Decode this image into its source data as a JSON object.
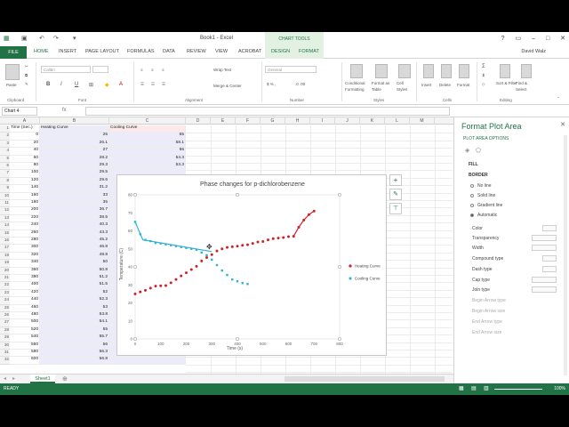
{
  "window": {
    "title": "Book1 - Excel",
    "chart_tools": "CHART TOOLS",
    "user": "David Walz"
  },
  "tabs": [
    "HOME",
    "INSERT",
    "PAGE LAYOUT",
    "FORMULAS",
    "DATA",
    "REVIEW",
    "VIEW",
    "ACROBAT",
    "DESIGN",
    "FORMAT"
  ],
  "file_tab": "FILE",
  "ribbon": {
    "groups": [
      "Clipboard",
      "Font",
      "Alignment",
      "Number",
      "Styles",
      "Cells",
      "Editing"
    ],
    "paste": "Paste",
    "font_name": "Calibri",
    "wrap_text": "Wrap Text",
    "merge_center": "Merge & Center",
    "number_format": "General",
    "conditional": "Conditional Formatting",
    "format_as_table": "Format as Table",
    "cell_styles": "Cell Styles",
    "insert": "Insert",
    "delete": "Delete",
    "format": "Format",
    "sort_filter": "Sort & Filter",
    "find_select": "Find & Select"
  },
  "formula_bar": {
    "name_box": "Chart 4",
    "fx": "fx"
  },
  "columns": [
    "A",
    "B",
    "C",
    "D",
    "E",
    "F",
    "G",
    "H",
    "I",
    "J",
    "K",
    "L",
    "M"
  ],
  "headers": [
    "Time (Sec.)",
    "Heating Curve",
    "Cooling Curve"
  ],
  "rows": [
    [
      "0",
      "25",
      "65"
    ],
    [
      "20",
      "26.1",
      "58.1"
    ],
    [
      "40",
      "27",
      "55"
    ],
    [
      "60",
      "28.2",
      "54.3"
    ],
    [
      "80",
      "29.3",
      "53.3"
    ],
    [
      "100",
      "29.5",
      ""
    ],
    [
      "120",
      "29.6",
      ""
    ],
    [
      "140",
      "31.2",
      ""
    ],
    [
      "160",
      "33",
      ""
    ],
    [
      "180",
      "35",
      ""
    ],
    [
      "200",
      "36.7",
      ""
    ],
    [
      "220",
      "38.5",
      ""
    ],
    [
      "240",
      "40.3",
      ""
    ],
    [
      "260",
      "43.3",
      ""
    ],
    [
      "280",
      "45.2",
      ""
    ],
    [
      "300",
      "46.8",
      ""
    ],
    [
      "320",
      "48.8",
      ""
    ],
    [
      "340",
      "50",
      ""
    ],
    [
      "360",
      "50.8",
      ""
    ],
    [
      "380",
      "51.2",
      ""
    ],
    [
      "400",
      "51.5",
      ""
    ],
    [
      "420",
      "52",
      ""
    ],
    [
      "440",
      "52.3",
      ""
    ],
    [
      "460",
      "53",
      ""
    ],
    [
      "480",
      "53.8",
      ""
    ],
    [
      "500",
      "54.1",
      ""
    ],
    [
      "520",
      "55",
      ""
    ],
    [
      "540",
      "55.7",
      ""
    ],
    [
      "560",
      "56",
      ""
    ],
    [
      "580",
      "56.3",
      ""
    ],
    [
      "600",
      "56.8",
      ""
    ]
  ],
  "chart_data": {
    "type": "scatter",
    "title": "Phase changes for p-dichlorobenzene",
    "xlabel": "Time (s)",
    "ylabel": "Temperature (C)",
    "xlim": [
      0,
      800
    ],
    "ylim": [
      0,
      80
    ],
    "xticks": [
      0,
      100,
      200,
      300,
      400,
      500,
      600,
      700,
      800
    ],
    "yticks": [
      0,
      10,
      20,
      30,
      40,
      50,
      60,
      70,
      80
    ],
    "legend_position": "right",
    "series": [
      {
        "name": "Heating Curve",
        "color": "#d0202a",
        "x": [
          0,
          20,
          40,
          60,
          80,
          100,
          120,
          140,
          160,
          180,
          200,
          220,
          240,
          260,
          280,
          300,
          320,
          340,
          360,
          380,
          400,
          420,
          440,
          460,
          480,
          500,
          520,
          540,
          560,
          580,
          600,
          620,
          640,
          660,
          680,
          700
        ],
        "y": [
          25,
          26.1,
          27,
          28.2,
          29.3,
          29.5,
          29.6,
          31.2,
          33,
          35,
          36.7,
          38.5,
          40.3,
          43.3,
          45.2,
          46.8,
          48.8,
          50,
          50.8,
          51.2,
          51.5,
          52,
          52.3,
          53,
          53.8,
          54.1,
          55,
          55.7,
          56,
          56.3,
          56.8,
          57,
          62,
          66,
          69,
          71
        ]
      },
      {
        "name": "Cooling Curve",
        "color": "#2fb0d6",
        "x": [
          0,
          20,
          40,
          60,
          80,
          100,
          120,
          140,
          160,
          180,
          200,
          220,
          240,
          260,
          280,
          300,
          320,
          340,
          360,
          380,
          400,
          420,
          440
        ],
        "y": [
          65,
          58.1,
          55,
          54.3,
          53.3,
          53,
          52.5,
          52,
          51.5,
          51,
          50.5,
          50,
          49.5,
          48,
          46.5,
          44,
          41,
          38,
          35.5,
          33,
          32,
          31,
          30.5
        ]
      }
    ],
    "trend_line": {
      "series": "Cooling Curve",
      "x": [
        0,
        30,
        300
      ],
      "y": [
        65,
        55,
        48.5
      ]
    }
  },
  "sheet_tab": "Sheet1",
  "status": {
    "ready": "READY",
    "zoom": "100%"
  },
  "pane": {
    "title": "Format Plot Area",
    "options": "PLOT AREA OPTIONS",
    "fill": "FILL",
    "border": "BORDER",
    "radios": [
      "No line",
      "Solid line",
      "Gradient line",
      "Automatic"
    ],
    "props": [
      "Color",
      "Transparency",
      "Width",
      "Compound type",
      "Dash type",
      "Cap type",
      "Join type",
      "Begin Arrow type",
      "Begin Arrow size",
      "End Arrow type",
      "End Arrow size"
    ]
  }
}
